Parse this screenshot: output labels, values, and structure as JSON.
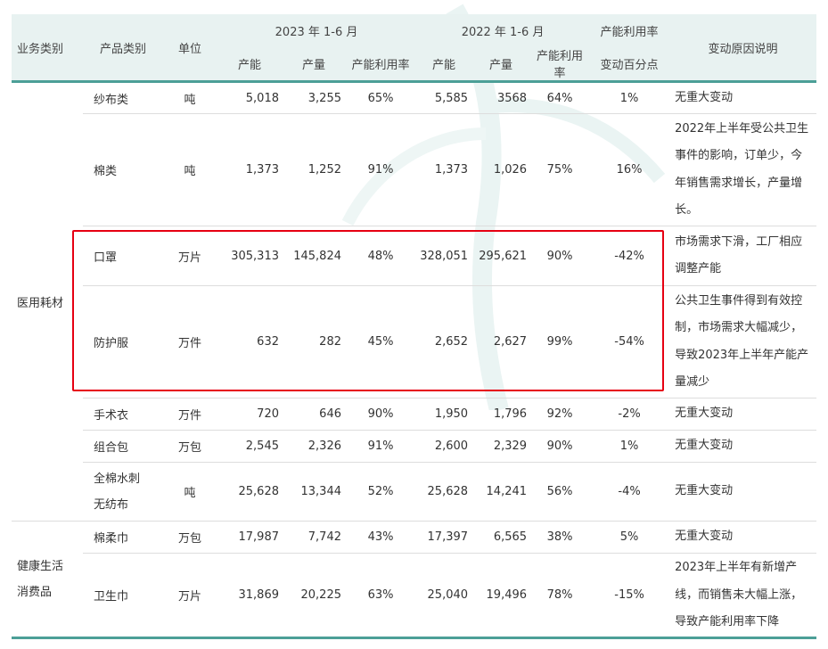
{
  "header": {
    "business_category": "业务类别",
    "product_category": "产品类别",
    "unit": "单位",
    "period_2023": "2023 年 1-6 月",
    "period_2022": "2022 年 1-6 月",
    "util_change_line1": "产能利用率",
    "util_change_line2": "变动百分点",
    "reason": "变动原因说明",
    "capacity": "产能",
    "output": "产量",
    "utilization": "产能利用率"
  },
  "groups": [
    {
      "name": "医用耗材"
    },
    {
      "name": "健康生活消费品"
    }
  ],
  "rows": [
    {
      "product": "纱布类",
      "unit": "吨",
      "cap23": "5,018",
      "out23": "3,255",
      "util23": "65%",
      "cap22": "5,585",
      "out22": "3568",
      "util22": "64%",
      "change": "1%",
      "reason": "无重大变动"
    },
    {
      "product": "棉类",
      "unit": "吨",
      "cap23": "1,373",
      "out23": "1,252",
      "util23": "91%",
      "cap22": "1,373",
      "out22": "1,026",
      "util22": "75%",
      "change": "16%",
      "reason": "2022年上半年受公共卫生事件的影响，订单少，今年销售需求增长，产量增长。"
    },
    {
      "product": "口罩",
      "unit": "万片",
      "cap23": "305,313",
      "out23": "145,824",
      "util23": "48%",
      "cap22": "328,051",
      "out22": "295,621",
      "util22": "90%",
      "change": "-42%",
      "reason": "市场需求下滑，工厂相应调整产能"
    },
    {
      "product": "防护服",
      "unit": "万件",
      "cap23": "632",
      "out23": "282",
      "util23": "45%",
      "cap22": "2,652",
      "out22": "2,627",
      "util22": "99%",
      "change": "-54%",
      "reason": "公共卫生事件得到有效控制，市场需求大幅减少，导致2023年上半年产能产量减少"
    },
    {
      "product": "手术衣",
      "unit": "万件",
      "cap23": "720",
      "out23": "646",
      "util23": "90%",
      "cap22": "1,950",
      "out22": "1,796",
      "util22": "92%",
      "change": "-2%",
      "reason": "无重大变动"
    },
    {
      "product": "组合包",
      "unit": "万包",
      "cap23": "2,545",
      "out23": "2,326",
      "util23": "91%",
      "cap22": "2,600",
      "out22": "2,329",
      "util22": "90%",
      "change": "1%",
      "reason": "无重大变动"
    },
    {
      "product": "全棉水刺无纺布",
      "unit": "吨",
      "cap23": "25,628",
      "out23": "13,344",
      "util23": "52%",
      "cap22": "25,628",
      "out22": "14,241",
      "util22": "56%",
      "change": "-4%",
      "reason": "无重大变动"
    },
    {
      "product": "棉柔巾",
      "unit": "万包",
      "cap23": "17,987",
      "out23": "7,742",
      "util23": "43%",
      "cap22": "17,397",
      "out22": "6,565",
      "util22": "38%",
      "change": "5%",
      "reason": "无重大变动"
    },
    {
      "product": "卫生巾",
      "unit": "万片",
      "cap23": "31,869",
      "out23": "20,225",
      "util23": "63%",
      "cap22": "25,040",
      "out22": "19,496",
      "util22": "78%",
      "change": "-15%",
      "reason": "2023年上半年有新增产线，而销售未大幅上涨，导致产能利用率下降"
    }
  ],
  "colors": {
    "header_bg": "#e8f2f1",
    "accent_line": "#4c9f97",
    "highlight_box": "#e60012",
    "text": "#333333"
  }
}
